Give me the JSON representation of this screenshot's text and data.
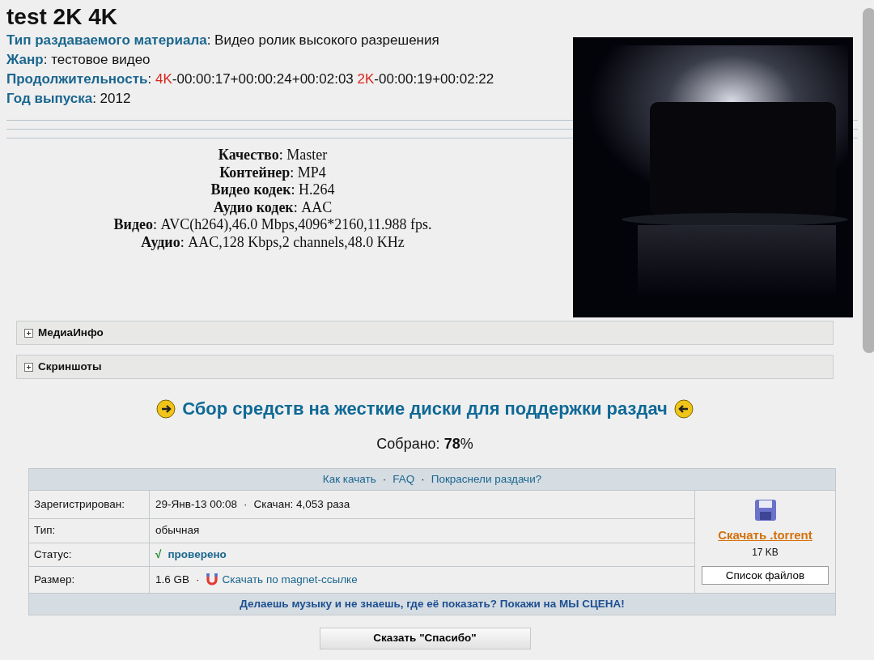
{
  "title": "test 2K 4K",
  "fields": [
    {
      "label": "Тип раздаваемого материала",
      "parts": [
        {
          "kind": "text",
          "text": ": Видео ролик высокого разрешения"
        }
      ]
    },
    {
      "label": "Жанр",
      "parts": [
        {
          "kind": "text",
          "text": ": тестовое видео"
        }
      ]
    },
    {
      "label": "Продолжительность",
      "parts": [
        {
          "kind": "text",
          "text": ": "
        },
        {
          "kind": "tag",
          "text": "4K"
        },
        {
          "kind": "text",
          "text": "-00:00:17+00:00:24+00:02:03 "
        },
        {
          "kind": "tag",
          "text": "2K"
        },
        {
          "kind": "text",
          "text": "-00:00:19+00:02:22"
        }
      ]
    },
    {
      "label": "Год выпуска",
      "parts": [
        {
          "kind": "text",
          "text": ": 2012"
        }
      ]
    }
  ],
  "specs": [
    {
      "label": "Качество",
      "value": ": Master"
    },
    {
      "label": "Контейнер",
      "value": ": MP4"
    },
    {
      "label": "Видео кодек",
      "value": ": H.264"
    },
    {
      "label": "Аудио кодек",
      "value": ": AAC"
    },
    {
      "label": "Видео",
      "value": ": AVC(h264),46.0 Mbps,4096*2160,11.988 fps."
    },
    {
      "label": "Аудио",
      "value": ": AAC,128 Kbps,2 channels,48.0 KHz"
    }
  ],
  "spoilers": [
    {
      "label": "МедиаИнфо",
      "expanded": false
    },
    {
      "label": "Скриншоты",
      "expanded": false
    }
  ],
  "fundraiser": {
    "title": "Сбор средств на жесткие диски для поддержки раздач",
    "collected": "Собрано: **78**%"
  },
  "torrent": {
    "links": [
      "Как качать",
      "FAQ",
      "Покраснели раздачи?"
    ],
    "link_separator": "·",
    "rows": [
      {
        "label": "Зарегистрирован:",
        "parts": [
          {
            "kind": "text",
            "text": "29-Янв-13 00:08"
          },
          {
            "kind": "sep",
            "text": "·"
          },
          {
            "kind": "text",
            "text": "Скачан: 4,053 раза"
          }
        ]
      },
      {
        "label": "Тип:",
        "parts": [
          {
            "kind": "text",
            "text": "обычная"
          }
        ]
      },
      {
        "label": "Статус:",
        "parts": [
          {
            "kind": "check",
            "text": "√"
          },
          {
            "kind": "status",
            "text": "проверено"
          }
        ]
      },
      {
        "label": "Размер:",
        "parts": [
          {
            "kind": "text",
            "text": "1.6 GB"
          },
          {
            "kind": "sep",
            "text": "·"
          },
          {
            "kind": "magnet",
            "text": "Скачать по magnet-ссылке"
          }
        ]
      }
    ],
    "download_link": "Скачать .torrent",
    "file_size": "17 KB",
    "files_button": "Список файлов",
    "footer": "Делаешь музыку и не знаешь, где её показать? Покажи на МЫ СЦЕНА!"
  },
  "thanks_button": "Сказать \"Спасибо\""
}
